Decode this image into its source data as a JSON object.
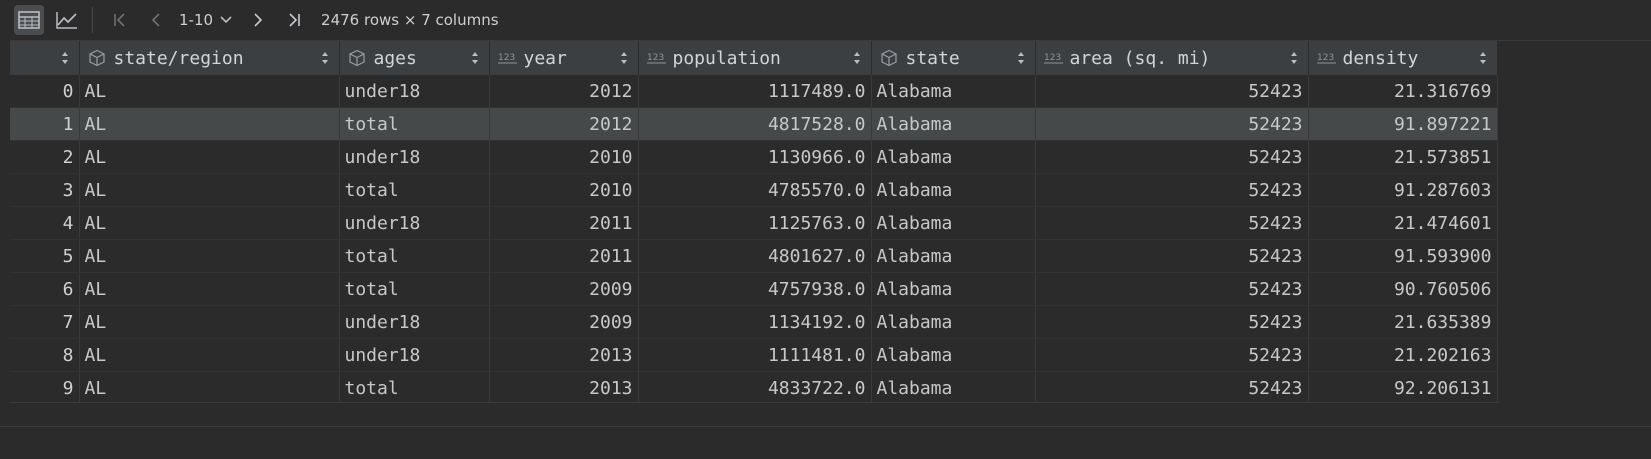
{
  "toolbar": {
    "page_range": "1-10",
    "rows_info": "2476 rows × 7 columns"
  },
  "table": {
    "columns": [
      {
        "label": "",
        "type": "index"
      },
      {
        "label": "state/region",
        "type": "object"
      },
      {
        "label": "ages",
        "type": "object"
      },
      {
        "label": "year",
        "type": "numeric"
      },
      {
        "label": "population",
        "type": "numeric"
      },
      {
        "label": "state",
        "type": "object"
      },
      {
        "label": "area (sq. mi)",
        "type": "numeric"
      },
      {
        "label": "density",
        "type": "numeric"
      }
    ],
    "rows": [
      [
        "0",
        "AL",
        "under18",
        "2012",
        "1117489.0",
        "Alabama",
        "52423",
        "21.316769"
      ],
      [
        "1",
        "AL",
        "total",
        "2012",
        "4817528.0",
        "Alabama",
        "52423",
        "91.897221"
      ],
      [
        "2",
        "AL",
        "under18",
        "2010",
        "1130966.0",
        "Alabama",
        "52423",
        "21.573851"
      ],
      [
        "3",
        "AL",
        "total",
        "2010",
        "4785570.0",
        "Alabama",
        "52423",
        "91.287603"
      ],
      [
        "4",
        "AL",
        "under18",
        "2011",
        "1125763.0",
        "Alabama",
        "52423",
        "21.474601"
      ],
      [
        "5",
        "AL",
        "total",
        "2011",
        "4801627.0",
        "Alabama",
        "52423",
        "91.593900"
      ],
      [
        "6",
        "AL",
        "total",
        "2009",
        "4757938.0",
        "Alabama",
        "52423",
        "90.760506"
      ],
      [
        "7",
        "AL",
        "under18",
        "2009",
        "1134192.0",
        "Alabama",
        "52423",
        "21.635389"
      ],
      [
        "8",
        "AL",
        "under18",
        "2013",
        "1111481.0",
        "Alabama",
        "52423",
        "21.202163"
      ],
      [
        "9",
        "AL",
        "total",
        "2013",
        "4833722.0",
        "Alabama",
        "52423",
        "92.206131"
      ]
    ],
    "selected_row": 1,
    "icons": {
      "object": "cube-icon",
      "numeric": "numeric-123-icon"
    }
  },
  "colors": {
    "background": "#2b2b2b",
    "header": "#3c3f41",
    "selected_row": "#45494a",
    "text": "#c8c8c8"
  }
}
